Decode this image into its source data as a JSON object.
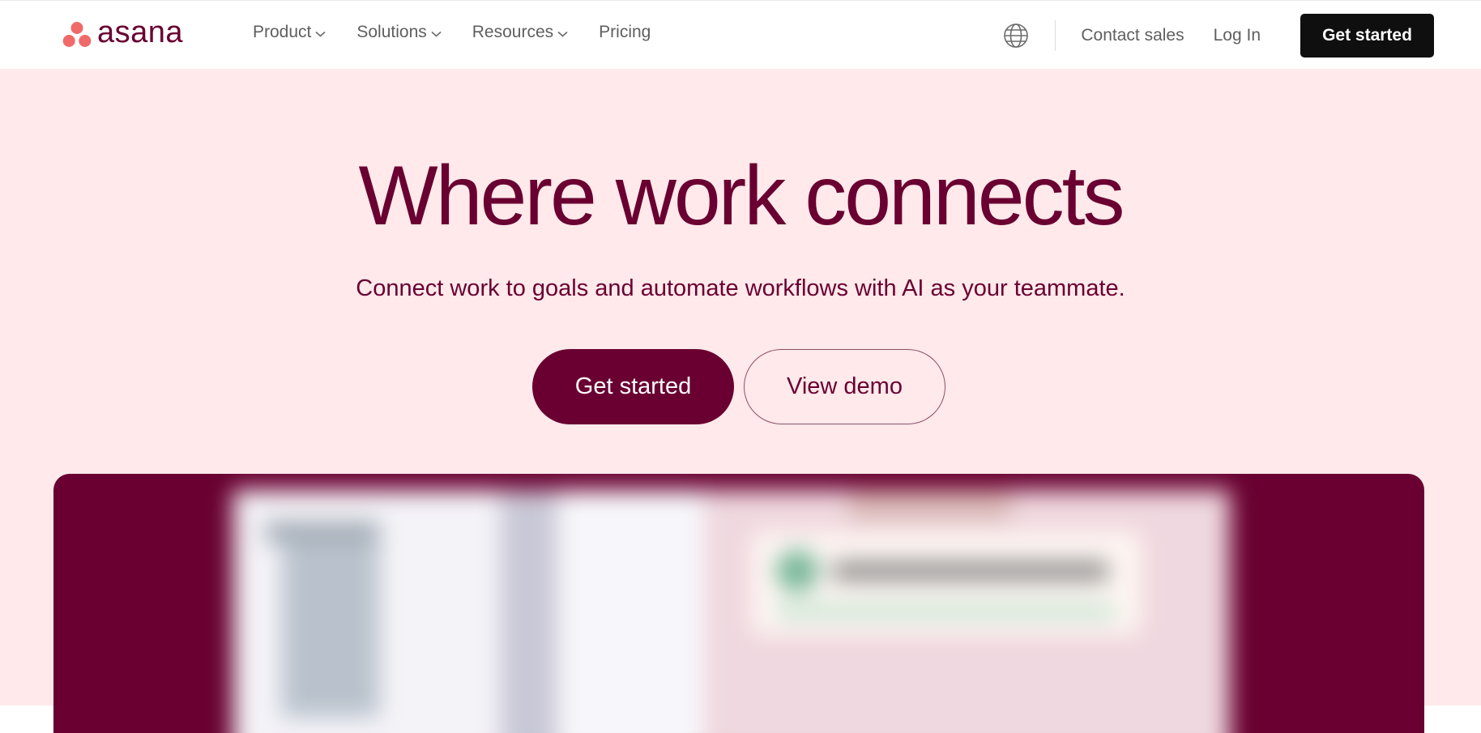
{
  "brand": {
    "name": "asana",
    "logo_color": "#f06a6a",
    "text_color": "#690031"
  },
  "nav": {
    "items": [
      {
        "label": "Product",
        "dropdown": true
      },
      {
        "label": "Solutions",
        "dropdown": true
      },
      {
        "label": "Resources",
        "dropdown": true
      },
      {
        "label": "Pricing",
        "dropdown": false
      }
    ]
  },
  "header_right": {
    "language_icon": "globe-icon",
    "contact_label": "Contact sales",
    "login_label": "Log In",
    "cta_label": "Get started"
  },
  "hero": {
    "headline": "Where work connects",
    "subheadline": "Connect work to goals and automate workflows with AI as your teammate.",
    "primary_cta": "Get started",
    "secondary_cta": "View demo",
    "background": "#ffe9ea",
    "accent": "#690031"
  }
}
